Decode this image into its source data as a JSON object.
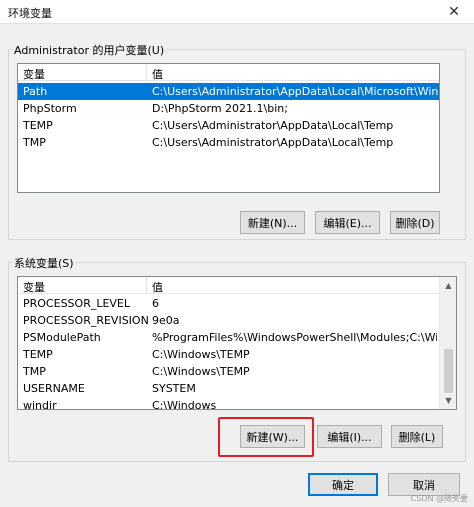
{
  "window": {
    "title": "环境变量",
    "close_glyph": "✕"
  },
  "user_vars": {
    "label": "Administrator 的用户变量(U)",
    "columns": {
      "name": "变量",
      "value": "值"
    },
    "rows": [
      {
        "name": "Path",
        "value": "C:\\Users\\Administrator\\AppData\\Local\\Microsoft\\WindowsA..."
      },
      {
        "name": "PhpStorm",
        "value": "D:\\PhpStorm 2021.1\\bin;"
      },
      {
        "name": "TEMP",
        "value": "C:\\Users\\Administrator\\AppData\\Local\\Temp"
      },
      {
        "name": "TMP",
        "value": "C:\\Users\\Administrator\\AppData\\Local\\Temp"
      }
    ],
    "buttons": {
      "new": "新建(N)...",
      "edit": "编辑(E)...",
      "delete": "删除(D)"
    }
  },
  "system_vars": {
    "label": "系统变量(S)",
    "columns": {
      "name": "变量",
      "value": "值"
    },
    "rows": [
      {
        "name": "PROCESSOR_LEVEL",
        "value": "6"
      },
      {
        "name": "PROCESSOR_REVISION",
        "value": "9e0a"
      },
      {
        "name": "PSModulePath",
        "value": "%ProgramFiles%\\WindowsPowerShell\\Modules;C:\\Windows\\..."
      },
      {
        "name": "TEMP",
        "value": "C:\\Windows\\TEMP"
      },
      {
        "name": "TMP",
        "value": "C:\\Windows\\TEMP"
      },
      {
        "name": "USERNAME",
        "value": "SYSTEM"
      },
      {
        "name": "windir",
        "value": "C:\\Windows"
      }
    ],
    "buttons": {
      "new": "新建(W)...",
      "edit": "编辑(I)...",
      "delete": "删除(L)"
    }
  },
  "footer": {
    "ok": "确定",
    "cancel": "取消"
  },
  "watermark": "CSDN @随笑要",
  "colors": {
    "selection": "#0078d7",
    "highlight": "#e02020"
  }
}
